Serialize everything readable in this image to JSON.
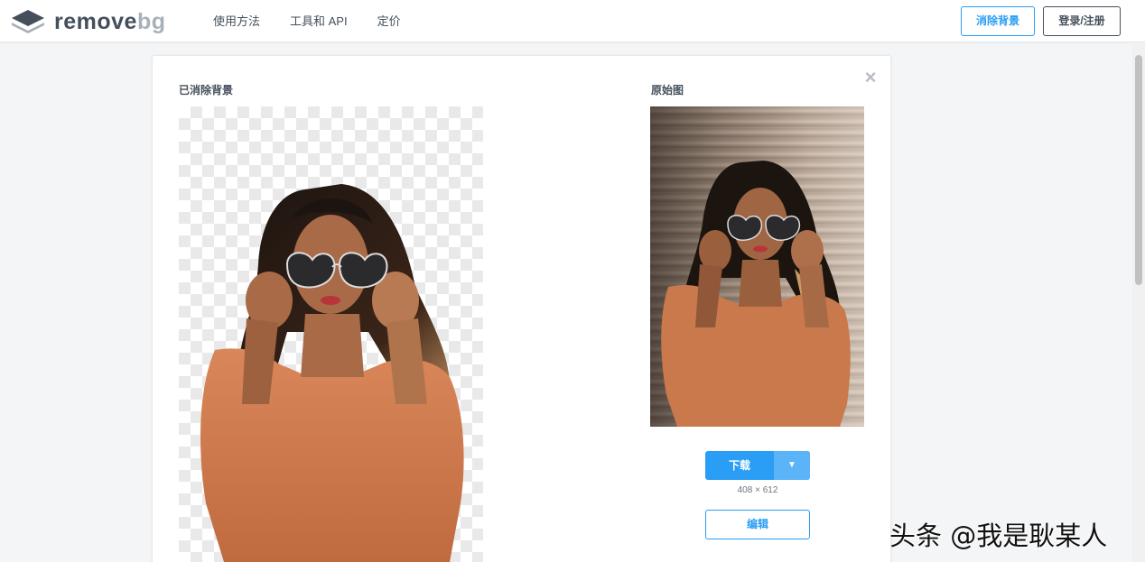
{
  "header": {
    "logo": {
      "word1": "remove",
      "word2": "bg"
    },
    "nav": [
      "使用方法",
      "工具和 API",
      "定价"
    ],
    "remove_bg_button": "消除背景",
    "login_button": "登录/注册"
  },
  "result": {
    "left_label": "已消除背景",
    "right_label": "原始图",
    "close_icon": "close-icon",
    "download_label": "下载",
    "dimensions": "408 × 612",
    "edit_label": "编辑"
  },
  "watermark": "头条 @我是耿某人",
  "colors": {
    "accent": "#2a9df4",
    "text": "#454f5b",
    "logo_light": "#a8b0b9"
  }
}
